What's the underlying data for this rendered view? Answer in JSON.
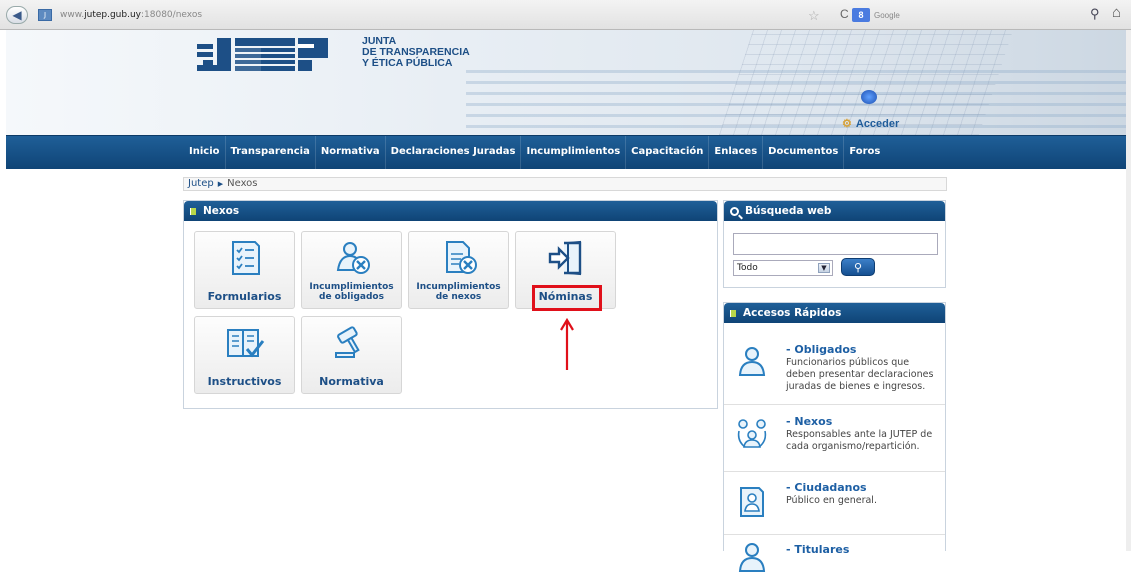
{
  "browser": {
    "url_prefix": "www.",
    "url_host": "jutep.gub.uy",
    "url_rest": ":18080/nexos",
    "search_engine": "Google"
  },
  "header": {
    "org_line1": "JUNTA",
    "org_line2": "DE TRANSPARENCIA",
    "org_line3": "Y ÉTICA PÚBLICA",
    "login_label": "Acceder"
  },
  "nav": {
    "items": [
      "Inicio",
      "Transparencia",
      "Normativa",
      "Declaraciones Juradas",
      "Incumplimientos",
      "Capacitación",
      "Enlaces",
      "Documentos",
      "Foros"
    ]
  },
  "breadcrumb": {
    "root": "Jutep",
    "current": "Nexos"
  },
  "nexos": {
    "title": "Nexos",
    "tiles": [
      {
        "label": "Formularios",
        "icon": "forms-icon"
      },
      {
        "label_line1": "Incumplimientos",
        "label_line2": "de obligados",
        "icon": "obligated-breach-icon"
      },
      {
        "label_line1": "Incumplimientos",
        "label_line2": "de nexos",
        "icon": "document-breach-icon"
      },
      {
        "label": "Nóminas",
        "icon": "door-enter-icon"
      },
      {
        "label": "Instructivos",
        "icon": "book-check-icon"
      },
      {
        "label": "Normativa",
        "icon": "gavel-icon"
      }
    ]
  },
  "search": {
    "title": "Búsqueda web",
    "select_value": "Todo"
  },
  "quick_access": {
    "title": "Accesos Rápidos",
    "items": [
      {
        "title": "- Obligados",
        "desc": "Funcionarios públicos que deben presentar declaraciones juradas de bienes e ingresos.",
        "icon": "person-icon"
      },
      {
        "title": "- Nexos",
        "desc": "Responsables ante la JUTEP de cada organismo/repartición.",
        "icon": "group-icon"
      },
      {
        "title": "- Ciudadanos",
        "desc": "Público en general.",
        "icon": "citizen-document-icon"
      },
      {
        "title": "- Titulares",
        "desc": "",
        "icon": "person-icon"
      }
    ]
  },
  "colors": {
    "primary_blue": "#1d4f86",
    "nav_blue": "#0f4476",
    "highlight_red": "#e0101a"
  }
}
